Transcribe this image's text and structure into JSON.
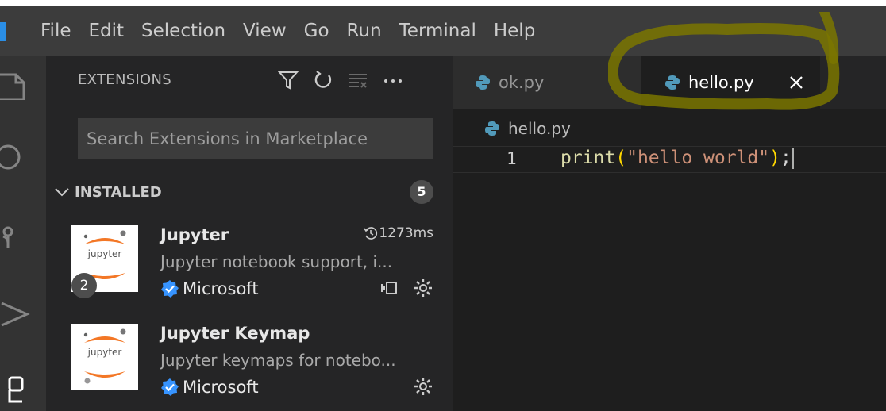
{
  "menubar": {
    "items": [
      "File",
      "Edit",
      "Selection",
      "View",
      "Go",
      "Run",
      "Terminal",
      "Help"
    ]
  },
  "activity_bar": {
    "icons": [
      "files-icon",
      "search-icon",
      "source-control-icon",
      "run-debug-icon",
      "extensions-icon"
    ]
  },
  "sidebar": {
    "title": "EXTENSIONS",
    "toolbar_icons": [
      "filter-icon",
      "refresh-icon",
      "clear-icon",
      "more-icon"
    ],
    "search_placeholder": "Search Extensions in Marketplace",
    "installed": {
      "label": "INSTALLED",
      "count": "5"
    },
    "extensions": [
      {
        "name": "Jupyter",
        "description": "Jupyter notebook support, i...",
        "publisher": "Microsoft",
        "timing": "1273ms",
        "logo_text": "jupyter",
        "badge": "2"
      },
      {
        "name": "Jupyter Keymap",
        "description": "Jupyter keymaps for notebo...",
        "publisher": "Microsoft",
        "logo_text": "jupyter"
      }
    ]
  },
  "editor": {
    "tabs": [
      {
        "label": "ok.py",
        "active": false
      },
      {
        "label": "hello.py",
        "active": true
      }
    ],
    "breadcrumb": "hello.py",
    "lines": [
      {
        "number": "1",
        "tokens": {
          "fn": "print",
          "open": "(",
          "str": "\"hello world\"",
          "close": ")",
          "semi": ";"
        }
      }
    ]
  },
  "colors": {
    "menubar_bg": "#3c3c3c",
    "sidebar_bg": "#252526",
    "editor_bg": "#1e1e1e",
    "verified_blue": "#3794ff",
    "python_blue": "#519aba",
    "highlight_marker": "#7a7500"
  }
}
